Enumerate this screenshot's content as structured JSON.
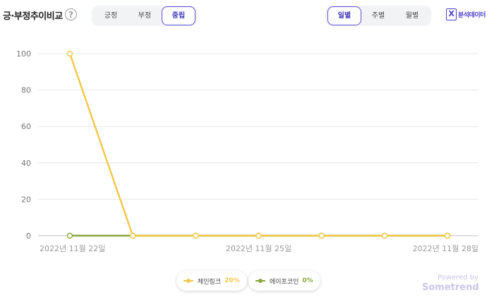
{
  "header": {
    "title": "긍·부정추이비교",
    "help_glyph": "?",
    "sentiment_tabs": [
      {
        "label": "긍정",
        "active": false
      },
      {
        "label": "부정",
        "active": false
      },
      {
        "label": "중립",
        "active": true
      }
    ],
    "period_tabs": [
      {
        "label": "일별",
        "active": true
      },
      {
        "label": "주별",
        "active": false
      },
      {
        "label": "월별",
        "active": false
      }
    ],
    "excel_label": "분석데이터",
    "excel_glyph": "X",
    "accent_color": "#4b3fc8"
  },
  "chart_data": {
    "type": "line",
    "x": [
      "2022-11-22",
      "2022-11-23",
      "2022-11-24",
      "2022-11-25",
      "2022-11-26",
      "2022-11-27",
      "2022-11-28"
    ],
    "xtick_labels": [
      "2022년 11월 22일",
      "2022년 11월 25일",
      "2022년 11월 28일"
    ],
    "xtick_dates": [
      "2022-11-22",
      "2022-11-25",
      "2022-11-28"
    ],
    "yticks": [
      0,
      20,
      40,
      60,
      80,
      100
    ],
    "ylim": [
      0,
      100
    ],
    "grid": true,
    "legend_position": "bottom-center",
    "series": [
      {
        "name": "체인링크",
        "legend_value": "20%",
        "color": "#f2c94c",
        "values": [
          100,
          0,
          0,
          0,
          0,
          0,
          0
        ]
      },
      {
        "name": "에이프코인",
        "legend_value": "0%",
        "color": "#8aa83a",
        "values": [
          0,
          0,
          0,
          0,
          0,
          0,
          0
        ]
      }
    ]
  },
  "footer": {
    "powered_label": "Powered by",
    "brand": "Sometrend"
  }
}
